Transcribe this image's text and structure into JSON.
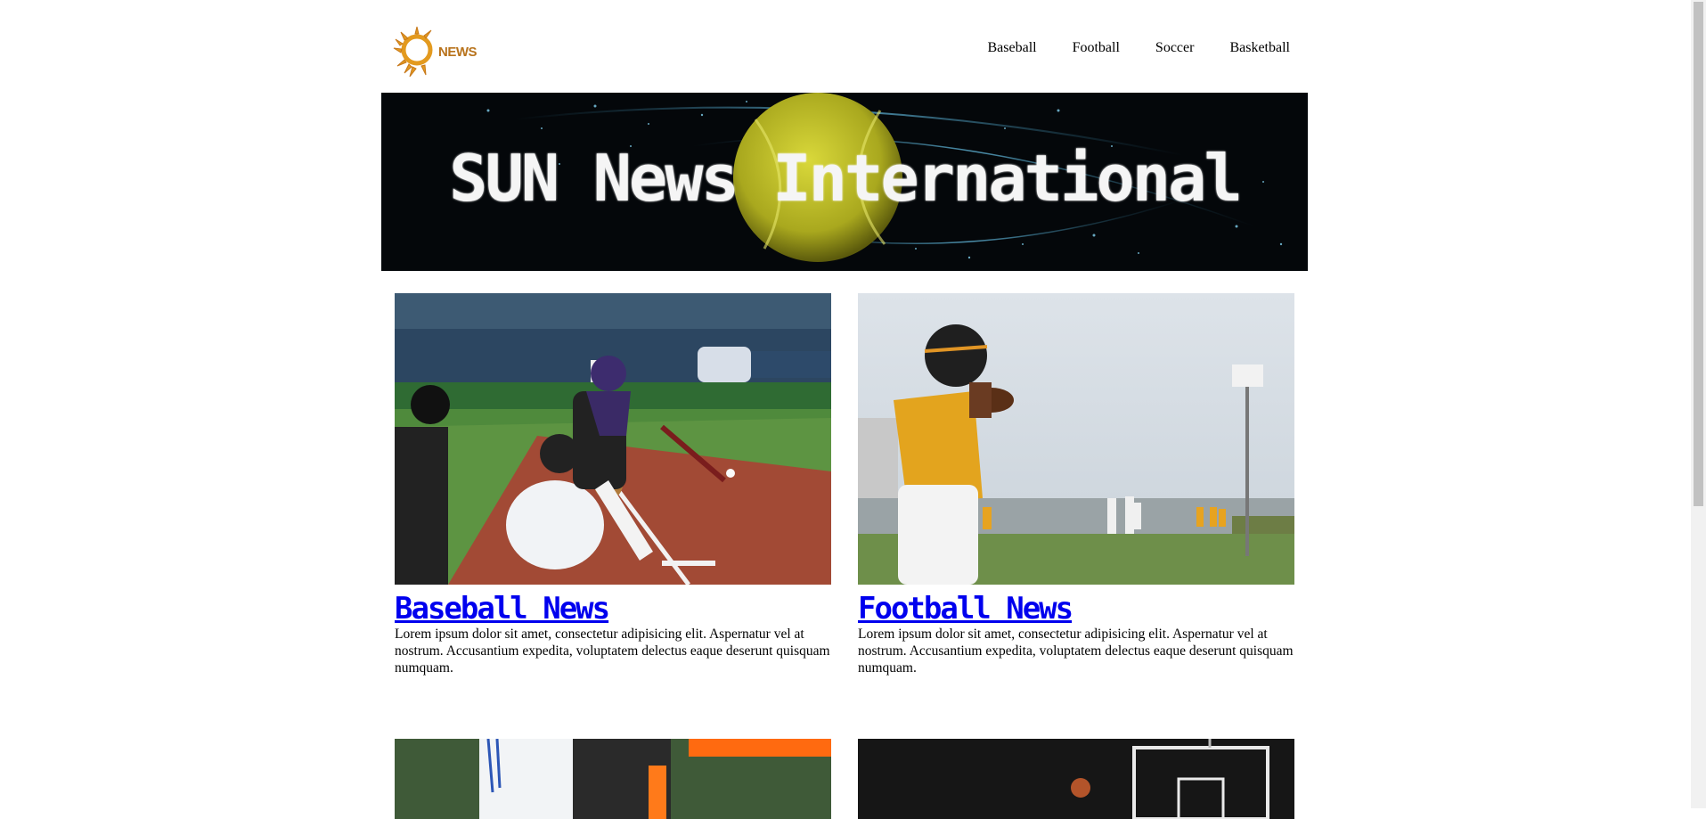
{
  "header": {
    "logo_text": "NEWS",
    "nav": [
      "Baseball",
      "Football",
      "Soccer",
      "Basketball"
    ]
  },
  "banner": {
    "title": "SUN News International"
  },
  "cards": [
    {
      "title": "Baseball News",
      "body": "Lorem ipsum dolor sit amet, consectetur adipisicing elit. Aspernatur vel at nostrum. Accusantium expedita, voluptatem delectus eaque deserunt quisquam numquam."
    },
    {
      "title": "Football News",
      "body": "Lorem ipsum dolor sit amet, consectetur adipisicing elit. Aspernatur vel at nostrum. Accusantium expedita, voluptatem delectus eaque deserunt quisquam numquam."
    }
  ],
  "icons": {
    "logo": "sun-news-logo-icon"
  },
  "colors": {
    "link": "#0000ee",
    "logo": "#b8731c"
  }
}
